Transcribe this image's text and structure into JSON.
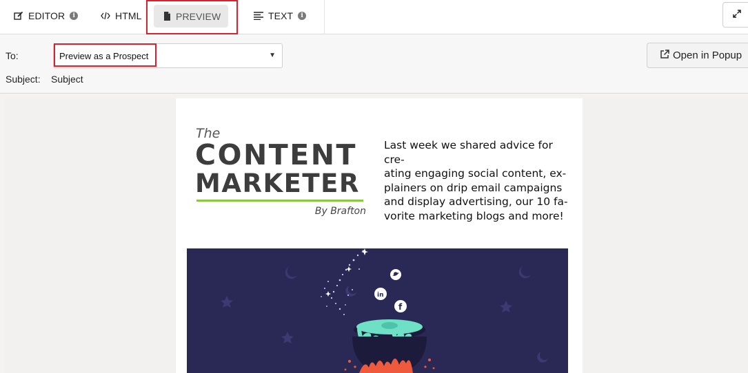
{
  "toolbar": {
    "tabs": [
      {
        "label": "EDITOR"
      },
      {
        "label": "HTML"
      },
      {
        "label": "PREVIEW"
      },
      {
        "label": "TEXT"
      }
    ]
  },
  "header": {
    "to_label": "To:",
    "to_select_value": "Preview as a Prospect",
    "subject_label": "Subject:",
    "subject_value": "Subject",
    "open_popup_label": "Open in Popup"
  },
  "email": {
    "logo": {
      "the": "The",
      "content": "CONTENT",
      "marketer": "MARKETER",
      "by": "By Brafton"
    },
    "intro_lines": [
      "Last week we shared advice for cre-",
      "ating engaging social content, ex-",
      "plainers on drip email campaigns",
      "and display advertising, our 10 fa-",
      "vorite marketing blogs and more!"
    ]
  },
  "colors": {
    "highlight": "#d6222f",
    "hero_bg": "#2a2956",
    "brand_green": "#8dc63f",
    "cauldron_liquid": "#6ee0c6",
    "flames": "#ef5a3c"
  }
}
